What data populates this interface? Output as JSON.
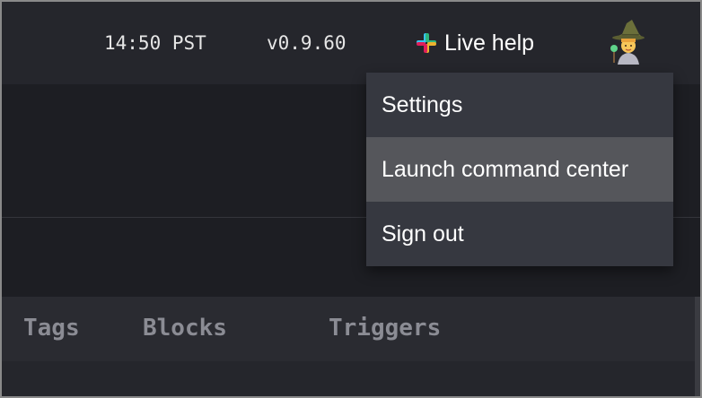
{
  "header": {
    "time": "14:50 PST",
    "version": "v0.9.60",
    "live_help_label": "Live help",
    "live_help_icon": "slack-icon",
    "avatar_icon": "mage-avatar-icon"
  },
  "dropdown_menu": {
    "items": [
      {
        "label": "Settings",
        "active": false
      },
      {
        "label": "Launch command center",
        "active": true
      },
      {
        "label": "Sign out",
        "active": false
      }
    ]
  },
  "tabs": [
    {
      "label": "Tags"
    },
    {
      "label": "Blocks"
    },
    {
      "label": "Triggers"
    }
  ],
  "colors": {
    "background": "#1c1d22",
    "header_bg": "#25262c",
    "menu_bg": "#363840",
    "menu_active_bg": "#55565b",
    "tab_text": "#8b8c94"
  }
}
